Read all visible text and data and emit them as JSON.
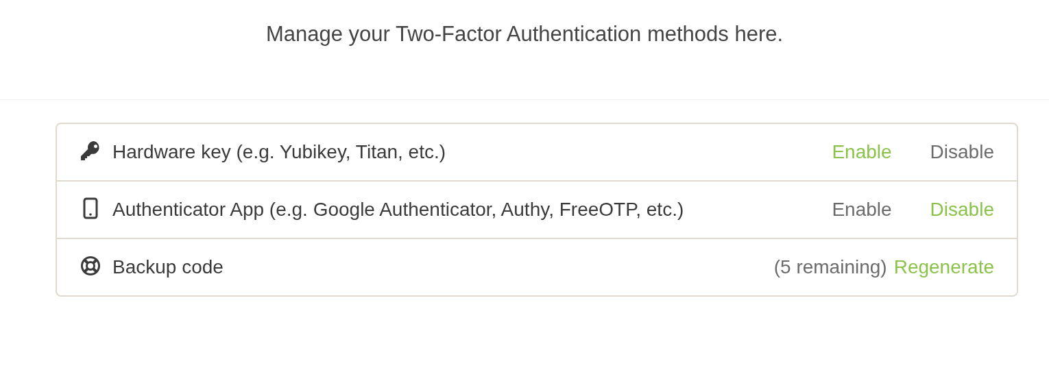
{
  "heading": "Manage your Two-Factor Authentication methods here.",
  "methods": [
    {
      "kind": "key",
      "label": "Hardware key (e.g. Yubikey, Titan, etc.)",
      "actions": [
        {
          "label": "Enable",
          "disabled": false
        },
        {
          "label": "Disable",
          "disabled": true
        }
      ]
    },
    {
      "kind": "phone",
      "label": "Authenticator App (e.g. Google Authenticator, Authy, FreeOTP, etc.)",
      "actions": [
        {
          "label": "Enable",
          "disabled": true
        },
        {
          "label": "Disable",
          "disabled": false
        }
      ]
    },
    {
      "kind": "lifebuoy",
      "label": "Backup code",
      "note": "(5 remaining)",
      "actions": [
        {
          "label": "Regenerate",
          "disabled": false
        }
      ]
    }
  ]
}
